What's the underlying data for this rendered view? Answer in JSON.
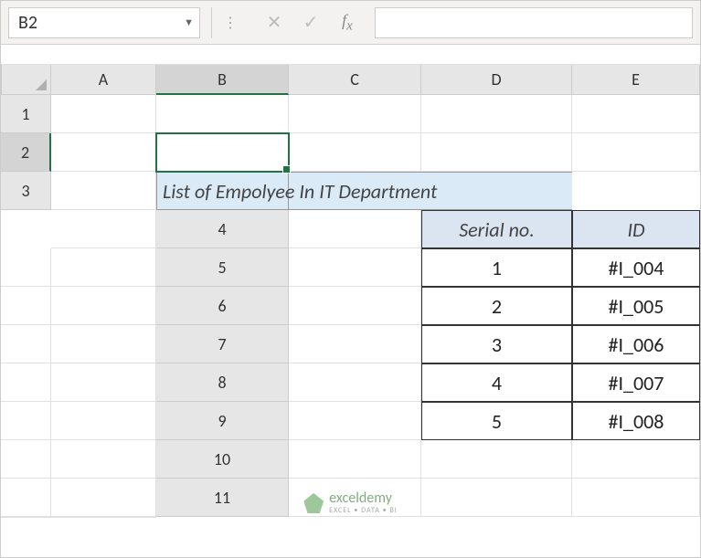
{
  "name_box": "B2",
  "formula_value": "",
  "columns": [
    "A",
    "B",
    "C",
    "D",
    "E"
  ],
  "rows": [
    "1",
    "2",
    "3",
    "4",
    "5",
    "6",
    "7",
    "8",
    "9",
    "10",
    "11"
  ],
  "active_col": "B",
  "active_row": "2",
  "title": "List of Empolyee In IT Department",
  "headers": {
    "serial": "Serial no.",
    "id": "ID"
  },
  "data_rows": [
    {
      "serial": "1",
      "id": "#I_004"
    },
    {
      "serial": "2",
      "id": "#I_005"
    },
    {
      "serial": "3",
      "id": "#I_006"
    },
    {
      "serial": "4",
      "id": "#I_007"
    },
    {
      "serial": "5",
      "id": "#I_008"
    }
  ],
  "watermark": {
    "brand": "exceldemy",
    "tagline": "EXCEL • DATA • BI"
  },
  "chart_data": {
    "type": "table",
    "title": "List of Empolyee In IT Department",
    "columns": [
      "Serial no.",
      "ID"
    ],
    "rows": [
      [
        1,
        "#I_004"
      ],
      [
        2,
        "#I_005"
      ],
      [
        3,
        "#I_006"
      ],
      [
        4,
        "#I_007"
      ],
      [
        5,
        "#I_008"
      ]
    ]
  }
}
